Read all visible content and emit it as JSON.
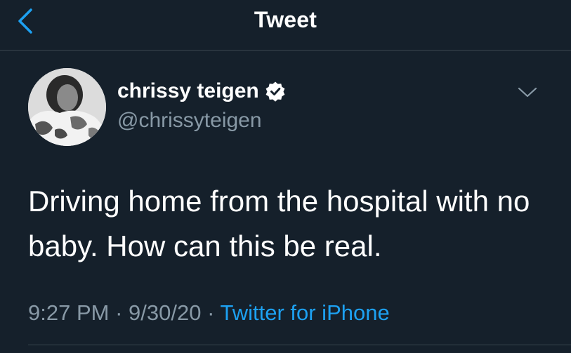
{
  "nav": {
    "title": "Tweet",
    "back_icon": "chevron-left-icon"
  },
  "colors": {
    "background": "#15202b",
    "accent": "#1da1f2",
    "muted": "#8899a6",
    "divider": "#38444d"
  },
  "author": {
    "name": "chrissy teigen",
    "handle": "@chrissyteigen",
    "verified_icon": "verified-badge-icon",
    "avatar": "avatar-photo"
  },
  "more_icon": "chevron-down-icon",
  "tweet": {
    "text": "Driving home from the hospital with no baby. How can this be real.",
    "time": "9:27 PM",
    "separator": "·",
    "date": "9/30/20",
    "source": "Twitter for iPhone"
  }
}
